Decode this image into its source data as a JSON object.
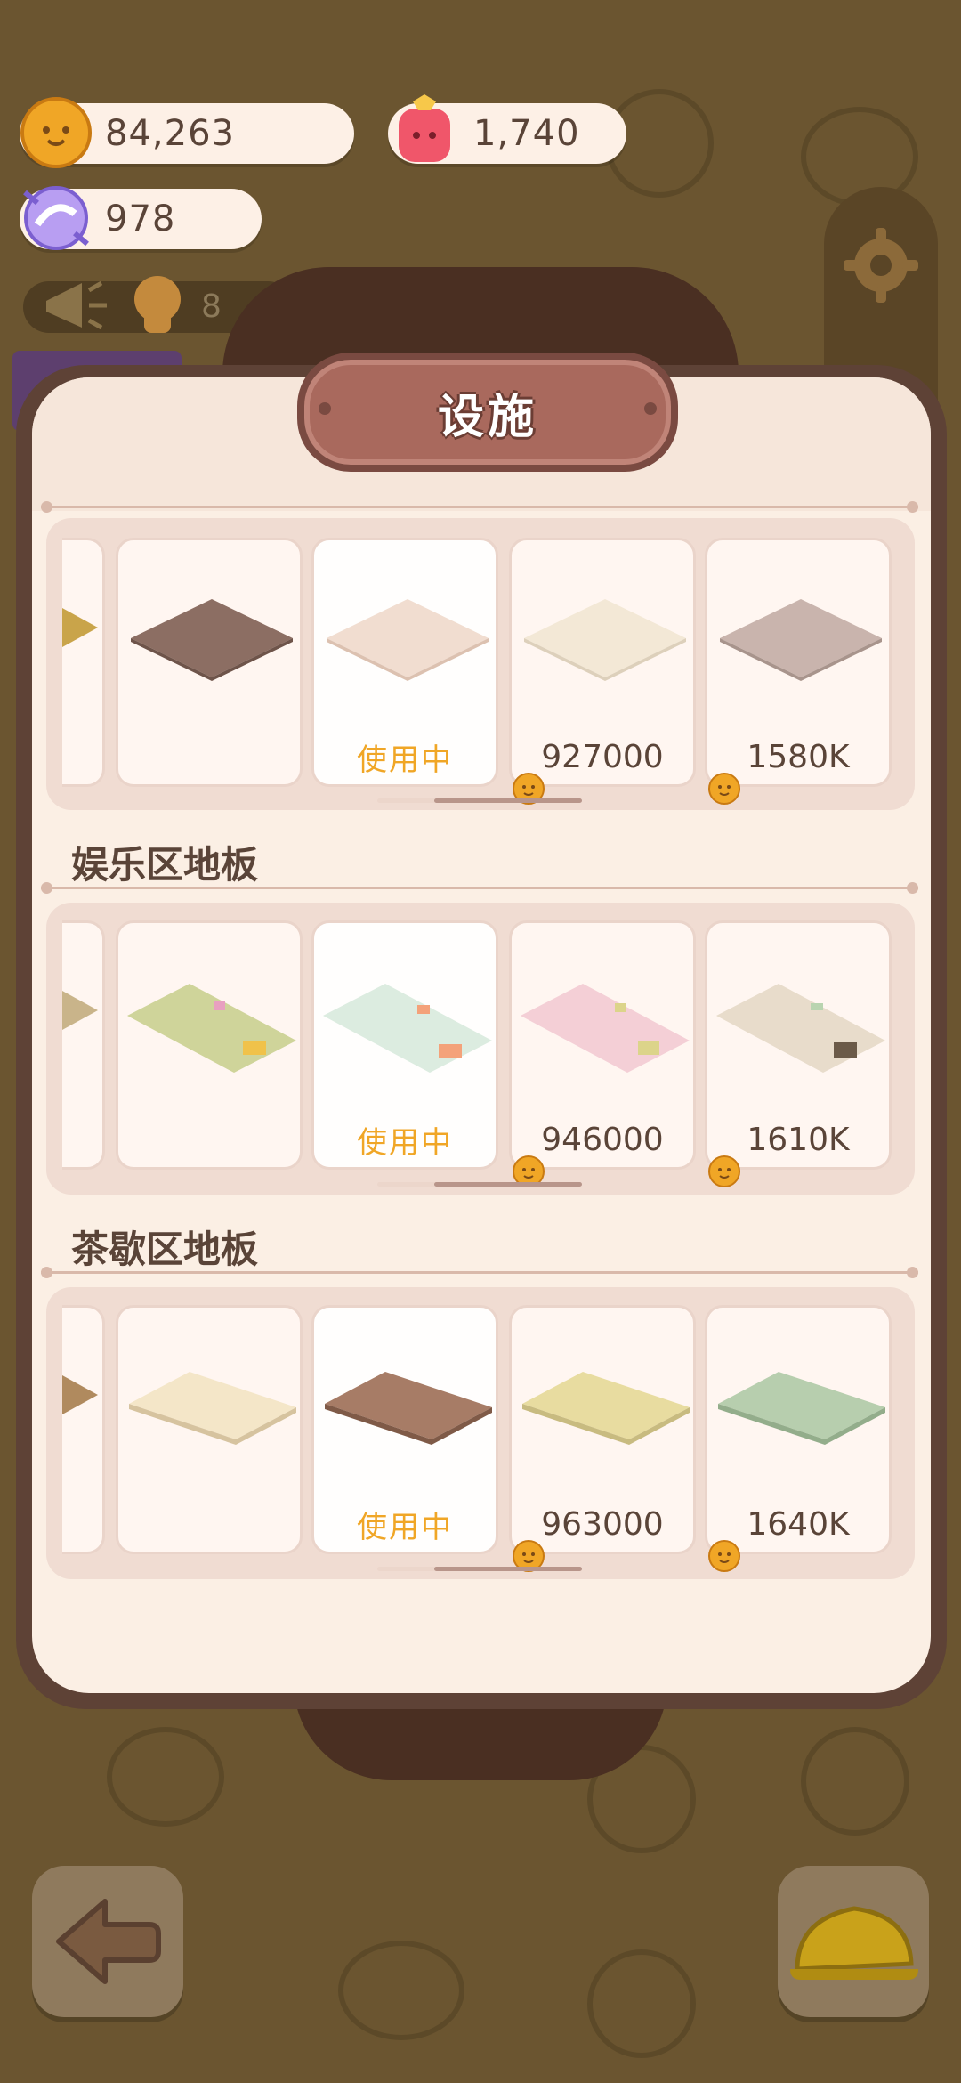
{
  "resources": {
    "cookies": "84,263",
    "gems": "1,740",
    "candy": "978"
  },
  "notice_count": "8",
  "panel": {
    "title": "设施"
  },
  "sections": [
    {
      "title": "",
      "items": [
        {
          "label": "",
          "status": "none"
        },
        {
          "label": "使用中",
          "status": "using"
        },
        {
          "label": "927000",
          "status": "price"
        },
        {
          "label": "1580K",
          "status": "price"
        }
      ]
    },
    {
      "title": "娱乐区地板",
      "items": [
        {
          "label": "",
          "status": "none"
        },
        {
          "label": "使用中",
          "status": "using"
        },
        {
          "label": "946000",
          "status": "price"
        },
        {
          "label": "1610K",
          "status": "price"
        }
      ]
    },
    {
      "title": "茶歇区地板",
      "items": [
        {
          "label": "",
          "status": "none"
        },
        {
          "label": "使用中",
          "status": "using"
        },
        {
          "label": "963000",
          "status": "price"
        },
        {
          "label": "1640K",
          "status": "price"
        }
      ]
    }
  ],
  "icons": {
    "cookie": "cookie-coin-icon",
    "gem": "pink-gem-icon",
    "candy": "candy-icon",
    "notice": "megaphone-icon",
    "settings": "gear-icon",
    "back": "back-arrow-icon",
    "build": "hard-hat-icon"
  },
  "colors": {
    "accent": "#f0a626",
    "panel": "#fbefe4",
    "frame": "#5e4236"
  }
}
